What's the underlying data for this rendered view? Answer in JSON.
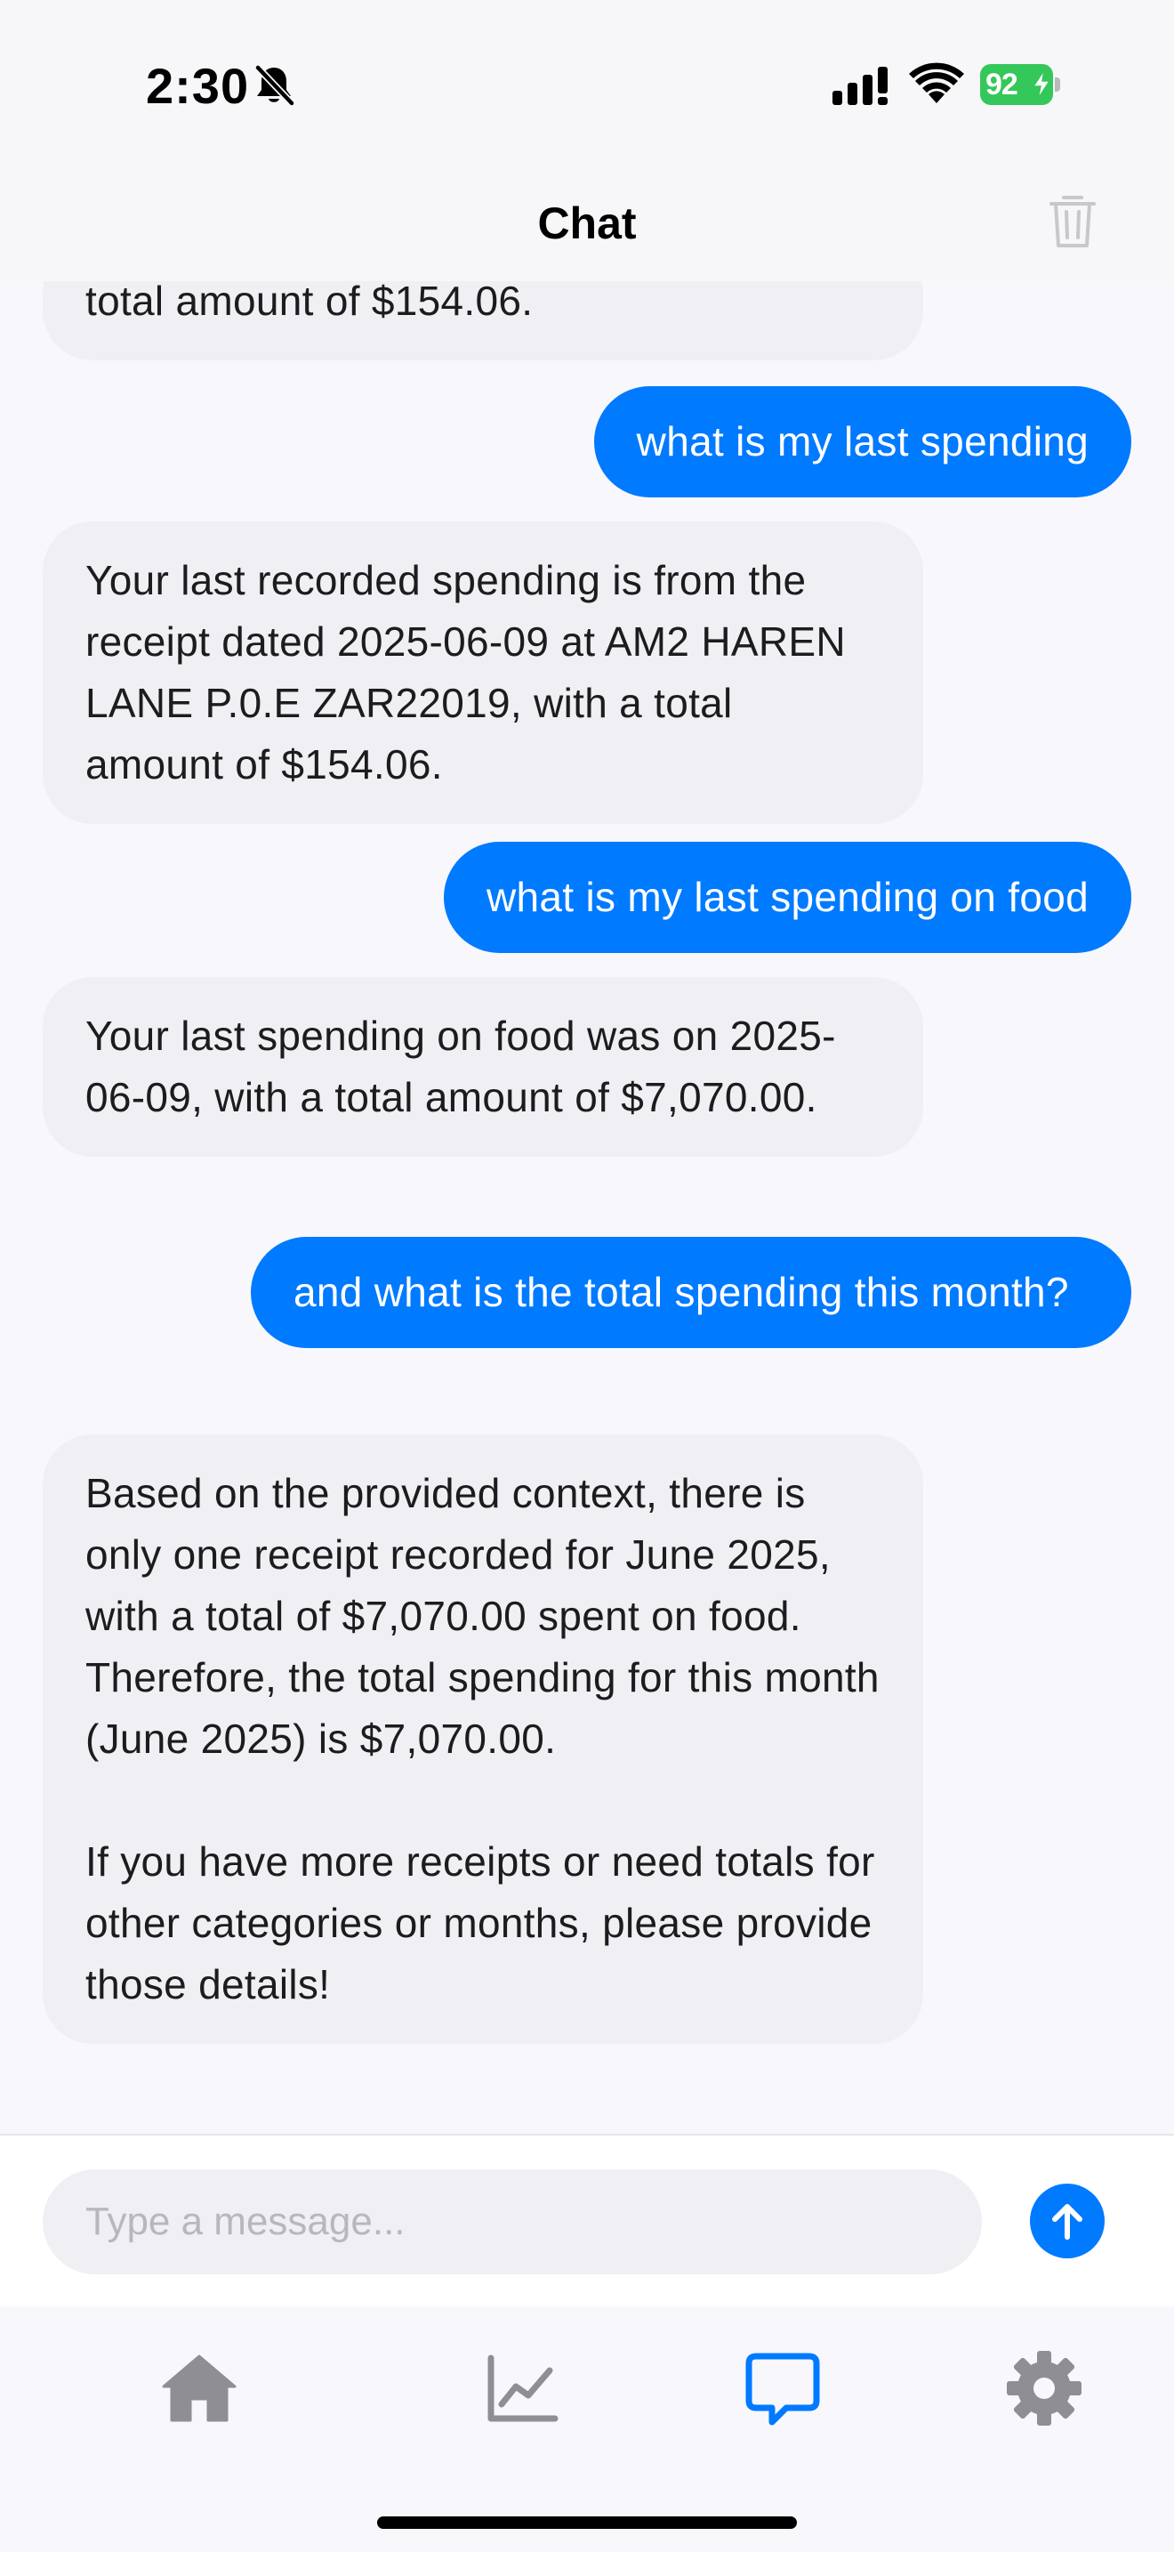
{
  "status_bar": {
    "time": "2:30",
    "battery": "92",
    "icons": [
      "bell-slash-icon",
      "cellular-signal-icon",
      "wifi-icon",
      "battery-charging-icon"
    ]
  },
  "header": {
    "title": "Chat",
    "trash_icon": "trash-icon"
  },
  "messages": [
    {
      "role": "assistant",
      "text": "total amount of $154.06."
    },
    {
      "role": "user",
      "text": "what is my last spending"
    },
    {
      "role": "assistant",
      "text": "Your last recorded spending is from the receipt dated 2025-06-09 at AM2 HAREN LANE P.0.E ZAR22019, with a total amount of $154.06."
    },
    {
      "role": "user",
      "text": "what is my last spending on food"
    },
    {
      "role": "assistant",
      "text": "Your last spending on food was on 2025-06-09, with a total amount of $7,070.00."
    },
    {
      "role": "user",
      "text": "and what is the total spending this month?"
    },
    {
      "role": "assistant",
      "text": "Based on the provided context, there is only one receipt recorded for June 2025, with a total of $7,070.00 spent on food. Therefore, the total spending for this month (June 2025) is $7,070.00.\n\nIf you have more receipts or need totals for other categories or months, please provide those details!"
    }
  ],
  "composer": {
    "placeholder": "Type a message...",
    "value": "",
    "send_icon": "arrow-up-icon"
  },
  "tab_bar": {
    "tabs": [
      {
        "icon": "home-icon",
        "active": false
      },
      {
        "icon": "chart-line-icon",
        "active": false
      },
      {
        "icon": "chat-bubble-icon",
        "active": true
      },
      {
        "icon": "gear-icon",
        "active": false
      }
    ]
  },
  "colors": {
    "accent": "#007aff",
    "assistant_bubble": "#efeff4",
    "inactive_icon": "#8e8e93",
    "battery": "#34c759"
  }
}
